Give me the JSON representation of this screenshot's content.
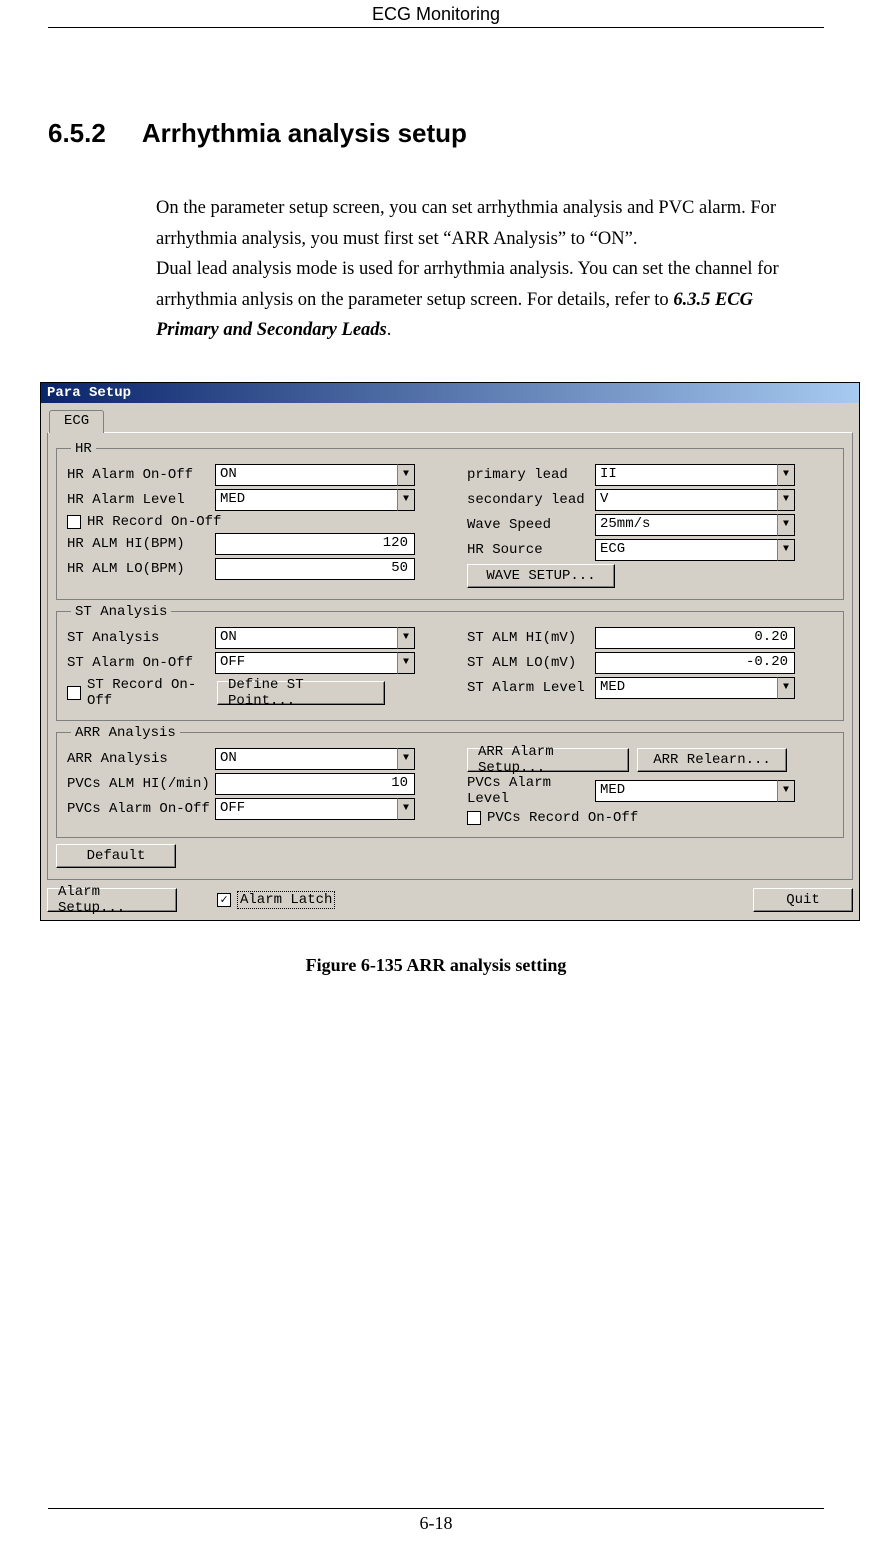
{
  "header": {
    "running": "ECG Monitoring"
  },
  "section": {
    "number": "6.5.2",
    "title": "Arrhythmia analysis setup"
  },
  "para1": "On the parameter setup screen, you can set arrhythmia analysis and PVC alarm. For arrhythmia analysis, you must first set “ARR Analysis” to “ON”.",
  "para2_a": "Dual lead analysis mode is used for arrhythmia analysis. You can set the channel for arrhythmia anlysis on the parameter setup screen. For details, refer to ",
  "para2_b": "6.3.5 ECG Primary and Secondary Leads",
  "para2_c": ".",
  "dialog": {
    "title": "Para Setup",
    "tab": "ECG",
    "hr_group": "HR",
    "hr": {
      "alarm_onoff_lbl": "HR Alarm On-Off",
      "alarm_onoff_val": "ON",
      "alarm_level_lbl": "HR Alarm Level",
      "alarm_level_val": "MED",
      "record_lbl": "HR Record On-Off",
      "alm_hi_lbl": "HR ALM HI(BPM)",
      "alm_hi_val": "120",
      "alm_lo_lbl": "HR ALM LO(BPM)",
      "alm_lo_val": "50",
      "primary_lbl": "primary lead",
      "primary_val": "II",
      "secondary_lbl": "secondary lead",
      "secondary_val": "V",
      "wave_speed_lbl": "Wave Speed",
      "wave_speed_val": "25mm/s",
      "hr_source_lbl": "HR Source",
      "hr_source_val": "ECG",
      "wave_setup_btn": "WAVE SETUP..."
    },
    "st_group": "ST Analysis",
    "st": {
      "analysis_lbl": "ST Analysis",
      "analysis_val": "ON",
      "alarm_onoff_lbl": "ST Alarm On-Off",
      "alarm_onoff_val": "OFF",
      "record_lbl": "ST Record On-Off",
      "define_btn": "Define ST Point...",
      "alm_hi_lbl": "ST ALM HI(mV)",
      "alm_hi_val": "0.20",
      "alm_lo_lbl": "ST ALM LO(mV)",
      "alm_lo_val": "-0.20",
      "alarm_level_lbl": "ST Alarm Level",
      "alarm_level_val": "MED"
    },
    "arr_group": "ARR Analysis",
    "arr": {
      "analysis_lbl": "ARR Analysis",
      "analysis_val": "ON",
      "pvcs_hi_lbl": "PVCs ALM HI(/min)",
      "pvcs_hi_val": "10",
      "pvcs_onoff_lbl": "PVCs Alarm On-Off",
      "pvcs_onoff_val": "OFF",
      "alarm_setup_btn": "ARR Alarm Setup...",
      "relearn_btn": "ARR Relearn...",
      "pvcs_level_lbl": "PVCs Alarm Level",
      "pvcs_level_val": "MED",
      "pvcs_record_lbl": "PVCs Record On-Off"
    },
    "default_btn": "Default",
    "alarm_setup_btn": "Alarm Setup...",
    "alarm_latch_lbl": "Alarm Latch",
    "quit_btn": "Quit"
  },
  "caption": "Figure 6-135 ARR analysis setting",
  "footer": {
    "page": "6-18"
  }
}
